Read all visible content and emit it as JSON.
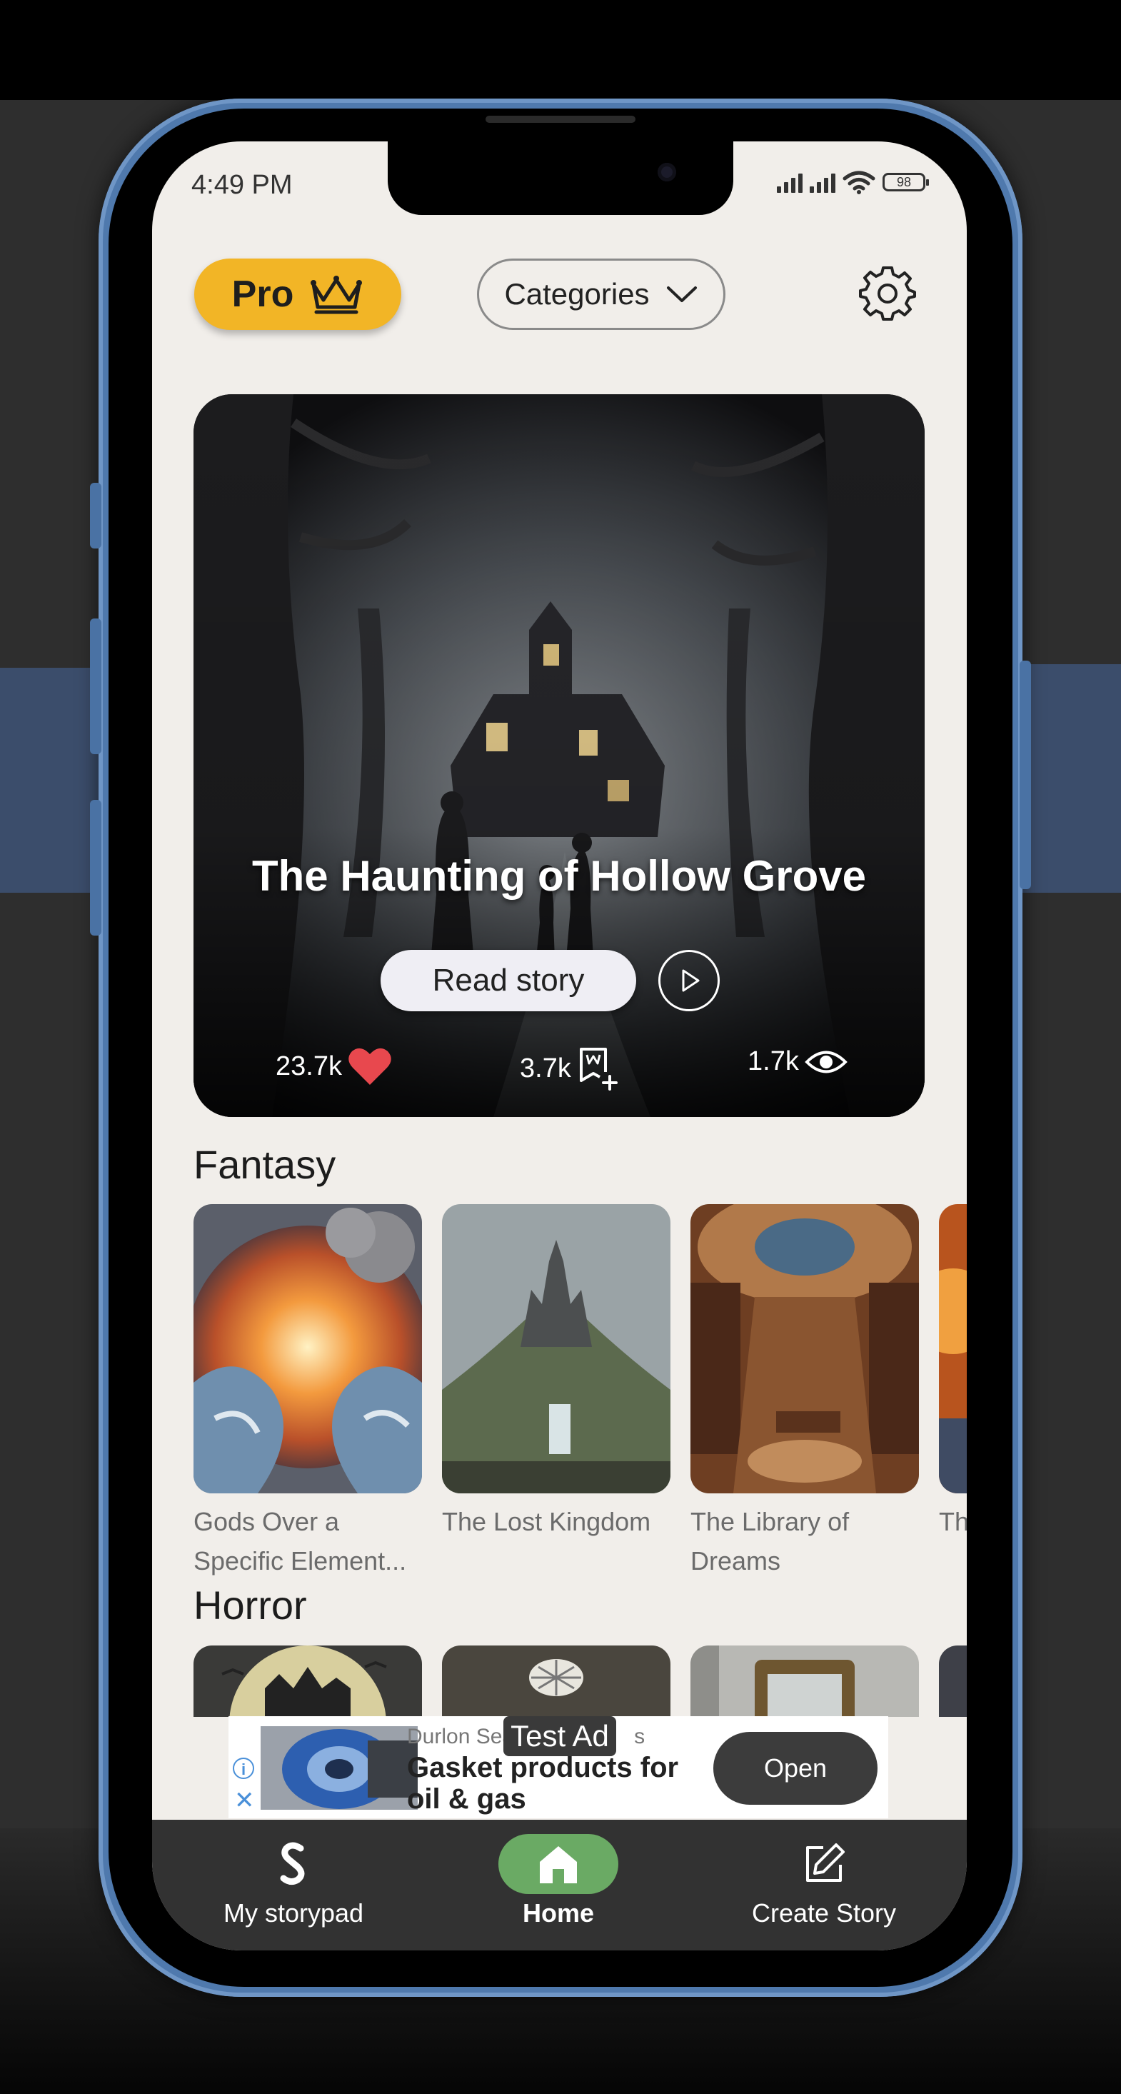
{
  "status_bar": {
    "time": "4:49 PM",
    "battery": "98"
  },
  "header": {
    "pro_label": "Pro",
    "categories_label": "Categories"
  },
  "hero": {
    "title": "The Haunting of Hollow Grove",
    "read_label": "Read story",
    "likes": "23.7k",
    "saves": "3.7k",
    "views": "1.7k"
  },
  "sections": {
    "fantasy": {
      "title": "Fantasy",
      "items": [
        {
          "title": "Gods Over a Specific Element..."
        },
        {
          "title": "The Lost Kingdom"
        },
        {
          "title": "The Library of Dreams"
        },
        {
          "title": "Th"
        }
      ]
    },
    "horror": {
      "title": "Horror"
    }
  },
  "ad": {
    "tag": "Test Ad",
    "advertiser": "Durlon Sea",
    "advertiser_suffix": "s",
    "headline": "Gasket products for oil & gas",
    "open_label": "Open",
    "info_glyph": "i",
    "close_glyph": "✕"
  },
  "bottom_nav": {
    "items": [
      {
        "label": "My storypad"
      },
      {
        "label": "Home"
      },
      {
        "label": "Create Story"
      }
    ]
  },
  "colors": {
    "screen_bg": "#f1eeea",
    "pro_yellow": "#f2b526",
    "nav_bg": "#323232",
    "home_green": "#6aaa64",
    "heart_red": "#e8484e",
    "frame_blue": "#4f79ad"
  }
}
